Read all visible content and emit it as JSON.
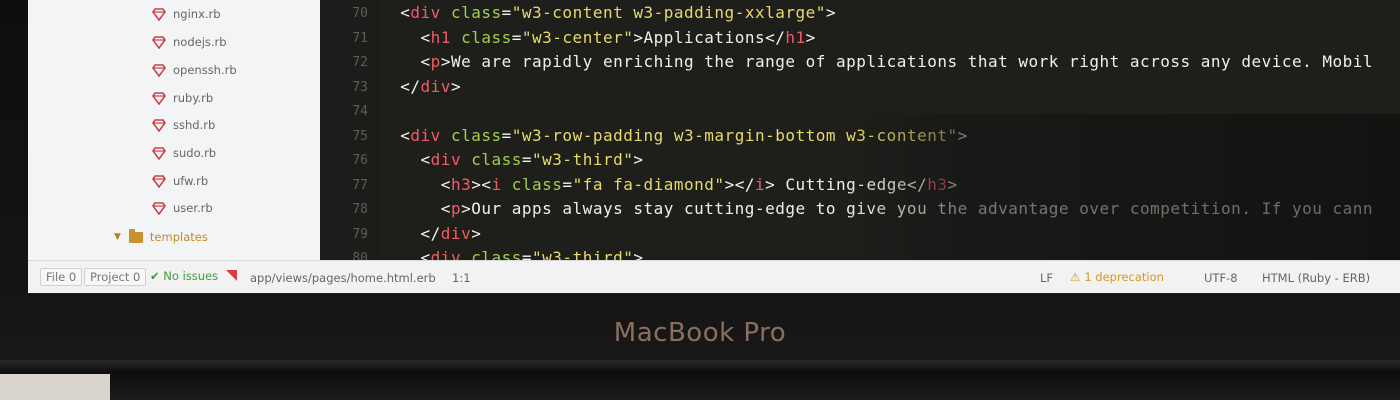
{
  "sidebar": {
    "items": [
      {
        "label": "nginx.rb",
        "icon": "ruby-icon"
      },
      {
        "label": "nodejs.rb",
        "icon": "ruby-icon"
      },
      {
        "label": "openssh.rb",
        "icon": "ruby-icon"
      },
      {
        "label": "ruby.rb",
        "icon": "ruby-icon"
      },
      {
        "label": "sshd.rb",
        "icon": "ruby-icon"
      },
      {
        "label": "sudo.rb",
        "icon": "ruby-icon"
      },
      {
        "label": "ufw.rb",
        "icon": "ruby-icon"
      },
      {
        "label": "user.rb",
        "icon": "ruby-icon"
      }
    ],
    "folder": {
      "label": "templates",
      "icon": "folder-icon"
    }
  },
  "editor": {
    "line_numbers": [
      "70",
      "71",
      "72",
      "73",
      "74",
      "75",
      "76",
      "77",
      "78",
      "79",
      "80"
    ],
    "lines": [
      {
        "indent": "  ",
        "parts": [
          [
            "punct",
            "<"
          ],
          [
            "tag",
            "div"
          ],
          [
            "punct",
            " "
          ],
          [
            "attr",
            "class"
          ],
          [
            "punct",
            "="
          ],
          [
            "str",
            "\"w3-content w3-padding-xxlarge\""
          ],
          [
            "punct",
            ">"
          ]
        ]
      },
      {
        "indent": "    ",
        "parts": [
          [
            "punct",
            "<"
          ],
          [
            "tag",
            "h1"
          ],
          [
            "punct",
            " "
          ],
          [
            "attr",
            "class"
          ],
          [
            "punct",
            "="
          ],
          [
            "str",
            "\"w3-center\""
          ],
          [
            "punct",
            ">"
          ],
          [
            "text",
            "Applications"
          ],
          [
            "punct",
            "</"
          ],
          [
            "tag",
            "h1"
          ],
          [
            "punct",
            ">"
          ]
        ]
      },
      {
        "indent": "    ",
        "parts": [
          [
            "punct",
            "<"
          ],
          [
            "tag",
            "p"
          ],
          [
            "punct",
            ">"
          ],
          [
            "text",
            "We are rapidly enriching the range of applications that work right across any device. Mobil"
          ]
        ]
      },
      {
        "indent": "  ",
        "parts": [
          [
            "punct",
            "</"
          ],
          [
            "tag",
            "div"
          ],
          [
            "punct",
            ">"
          ]
        ]
      },
      {
        "indent": "",
        "parts": []
      },
      {
        "indent": "  ",
        "parts": [
          [
            "punct",
            "<"
          ],
          [
            "tag",
            "div"
          ],
          [
            "punct",
            " "
          ],
          [
            "attr",
            "class"
          ],
          [
            "punct",
            "="
          ],
          [
            "str",
            "\"w3-row-padding w3-margin-bottom w3-content\""
          ],
          [
            "punct",
            ">"
          ]
        ]
      },
      {
        "indent": "    ",
        "parts": [
          [
            "punct",
            "<"
          ],
          [
            "tag",
            "div"
          ],
          [
            "punct",
            " "
          ],
          [
            "attr",
            "class"
          ],
          [
            "punct",
            "="
          ],
          [
            "str",
            "\"w3-third\""
          ],
          [
            "punct",
            ">"
          ]
        ]
      },
      {
        "indent": "      ",
        "parts": [
          [
            "punct",
            "<"
          ],
          [
            "tag",
            "h3"
          ],
          [
            "punct",
            "><"
          ],
          [
            "tag",
            "i"
          ],
          [
            "punct",
            " "
          ],
          [
            "attr",
            "class"
          ],
          [
            "punct",
            "="
          ],
          [
            "str",
            "\"fa fa-diamond\""
          ],
          [
            "punct",
            "></"
          ],
          [
            "tag",
            "i"
          ],
          [
            "punct",
            "> "
          ],
          [
            "text",
            "Cutting-edge"
          ],
          [
            "punct",
            "</"
          ],
          [
            "tag",
            "h3"
          ],
          [
            "punct",
            ">"
          ]
        ]
      },
      {
        "indent": "      ",
        "parts": [
          [
            "punct",
            "<"
          ],
          [
            "tag",
            "p"
          ],
          [
            "punct",
            ">"
          ],
          [
            "text",
            "Our apps always stay cutting-edge to give you the advantage over competition. If you cann"
          ]
        ]
      },
      {
        "indent": "    ",
        "parts": [
          [
            "punct",
            "</"
          ],
          [
            "tag",
            "div"
          ],
          [
            "punct",
            ">"
          ]
        ]
      },
      {
        "indent": "    ",
        "parts": [
          [
            "punct",
            "<"
          ],
          [
            "tag",
            "div"
          ],
          [
            "punct",
            " "
          ],
          [
            "attr",
            "class"
          ],
          [
            "punct",
            "="
          ],
          [
            "str",
            "\"w3-third\""
          ],
          [
            "punct",
            ">"
          ]
        ]
      }
    ]
  },
  "status_bar": {
    "file_label": "File 0",
    "project_label": "Project 0",
    "linter_status": "No issues",
    "file_path": "app/views/pages/home.html.erb",
    "cursor_position": "1:1",
    "line_ending": "LF",
    "deprecation": "1 deprecation",
    "encoding": "UTF-8",
    "grammar": "HTML (Ruby - ERB)"
  },
  "device": {
    "brand_label": "MacBook Pro"
  },
  "colors": {
    "tag": "#f25a66",
    "attribute": "#9fd04a",
    "string": "#e8d96b",
    "text": "#f0f0ea",
    "ok": "#3f9b3f",
    "warning": "#d39a22",
    "ruby_icon": "#c9414a"
  }
}
